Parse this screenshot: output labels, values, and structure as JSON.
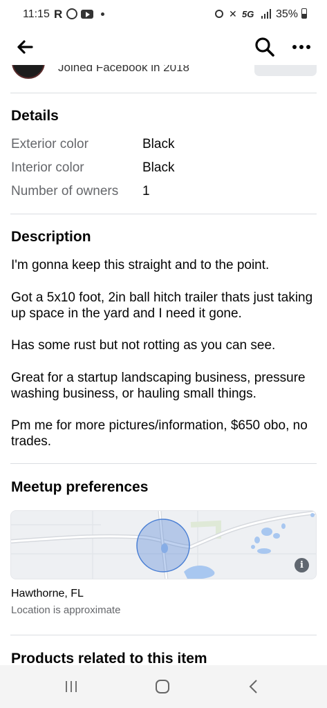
{
  "status": {
    "time": "11:15",
    "carrier_icon": "R",
    "network": "5G",
    "battery": "35%"
  },
  "seller": {
    "joined_text": "Joined Facebook in 2018"
  },
  "details": {
    "title": "Details",
    "rows": [
      {
        "label": "Exterior color",
        "value": "Black"
      },
      {
        "label": "Interior color",
        "value": "Black"
      },
      {
        "label": "Number of owners",
        "value": "1"
      }
    ]
  },
  "description": {
    "title": "Description",
    "paragraphs": [
      "I'm gonna keep this straight and to the point.",
      "Got a 5x10 foot, 2in ball hitch trailer thats just taking up space in the yard and I need it gone.",
      "Has some rust but not rotting as you can see.",
      "Great for a startup landscaping business, pressure washing business, or hauling small things.",
      "Pm me for more pictures/information, $650 obo, no trades."
    ]
  },
  "meetup": {
    "title": "Meetup preferences",
    "location": "Hawthorne, FL",
    "note": "Location is approximate",
    "info_glyph": "i"
  },
  "related": {
    "title": "Products related to this item"
  },
  "icons": {
    "back": "back-arrow-icon",
    "search": "search-icon",
    "more": "more-dots-icon"
  },
  "colors": {
    "text_primary": "#050505",
    "text_secondary": "#65676b",
    "divider": "#dadde1",
    "map_radius": "#4a7fd4"
  }
}
